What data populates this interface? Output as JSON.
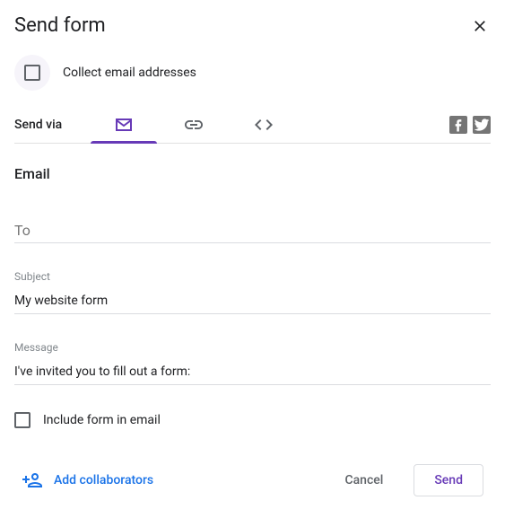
{
  "dialog": {
    "title": "Send form",
    "collect_emails_label": "Collect email addresses",
    "send_via_label": "Send via"
  },
  "email": {
    "section_title": "Email",
    "to_label": "To",
    "to_value": "",
    "subject_label": "Subject",
    "subject_value": "My website form",
    "message_label": "Message",
    "message_value": "I've invited you to fill out a form:",
    "include_form_label": "Include form in email"
  },
  "footer": {
    "add_collaborators_label": "Add collaborators",
    "cancel_label": "Cancel",
    "send_label": "Send"
  },
  "tabs": {
    "active": "email"
  }
}
